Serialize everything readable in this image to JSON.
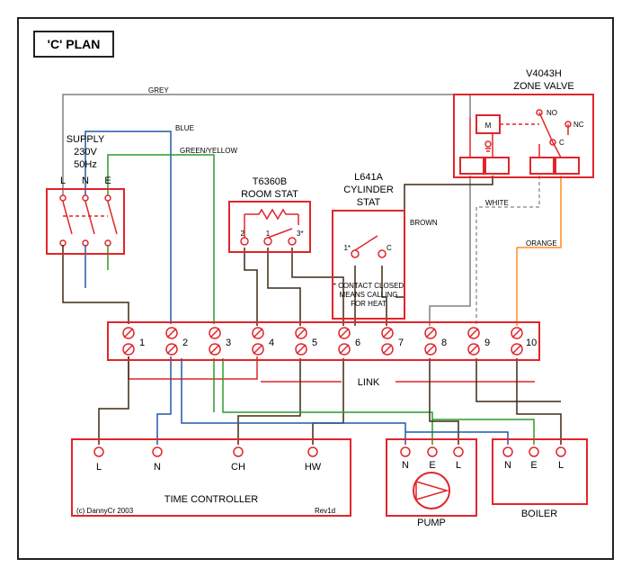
{
  "title": "'C' PLAN",
  "supply": {
    "label": "SUPPLY",
    "voltage": "230V",
    "freq": "50Hz",
    "pins": [
      "L",
      "N",
      "E"
    ]
  },
  "roomstat": {
    "model": "T6360B",
    "label": "ROOM STAT",
    "pins": [
      "2",
      "1",
      "3*"
    ]
  },
  "cylstat": {
    "model": "L641A",
    "label1": "CYLINDER",
    "label2": "STAT",
    "pins": [
      "1*",
      "C"
    ],
    "note1": "* CONTACT CLOSED",
    "note2": "MEANS CALLING",
    "note3": "FOR HEAT"
  },
  "valve": {
    "model": "V4043H",
    "label": "ZONE VALVE",
    "m": "M",
    "no": "NO",
    "nc": "NC",
    "c": "C"
  },
  "junction": {
    "terminals": [
      "1",
      "2",
      "3",
      "4",
      "5",
      "6",
      "7",
      "8",
      "9",
      "10"
    ],
    "link_label": "LINK"
  },
  "time": {
    "label": "TIME CONTROLLER",
    "pins": [
      "L",
      "N",
      "CH",
      "HW"
    ],
    "copyright": "(c) DannyCr 2003",
    "rev": "Rev1d"
  },
  "pump": {
    "label": "PUMP",
    "pins": [
      "N",
      "E",
      "L"
    ]
  },
  "boiler": {
    "label": "BOILER",
    "pins": [
      "N",
      "E",
      "L"
    ]
  },
  "wire_labels": {
    "grey": "GREY",
    "blue": "BLUE",
    "gy": "GREEN/YELLOW",
    "brown": "BROWN",
    "white": "WHITE",
    "orange": "ORANGE"
  }
}
